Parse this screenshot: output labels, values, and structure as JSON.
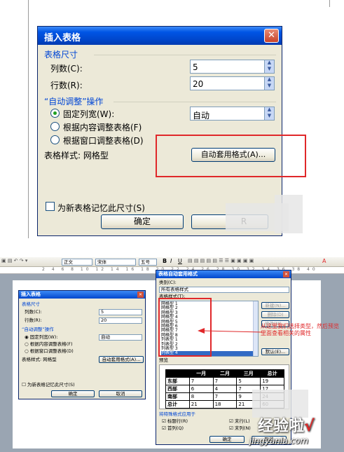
{
  "top_dialog": {
    "title": "插入表格",
    "close_glyph": "✕",
    "size_group": "表格尺寸",
    "columns_label": "列数(C):",
    "columns_value": "5",
    "rows_label": "行数(R):",
    "rows_value": "20",
    "autofit_group": "“自动调整”操作",
    "radio_fixed": "固定列宽(W):",
    "fixed_value": "自动",
    "radio_content": "根据内容调整表格(F)",
    "radio_window": "根据窗口调整表格(D)",
    "style_label": "表格样式: 网格型",
    "autoformat_button": "自动套用格式(A)...",
    "remember_label": "为新表格记忆此尺寸(S)",
    "ok_button": "确定",
    "cancel_partial": "R"
  },
  "toolbar": {
    "style_box": "正文",
    "font_box": "宋体",
    "size_box": "五号",
    "bold": "B",
    "italic": "I",
    "underline": "U",
    "font_color": "A"
  },
  "mini_dialog": {
    "title": "插入表格",
    "size_group": "表格尺寸",
    "columns_label": "列数(C):",
    "columns_value": "5",
    "rows_label": "行数(R):",
    "rows_value": "20",
    "autofit_group": "“自动调整”操作",
    "radio_fixed": "固定列宽(W):",
    "fixed_value": "自动",
    "radio_content": "根据内容调整表格(F)",
    "radio_window": "根据窗口调整表格(D)",
    "style_label": "表格样式: 网格型",
    "autoformat_button": "自动套用格式(A)...",
    "remember_label": "为新表格记忆此尺寸(S)",
    "ok_button": "确定",
    "cancel_button": "取消"
  },
  "autoformat_dialog": {
    "title": "表格自动套用格式",
    "category_label": "类别(C):",
    "category_value": "所有表格样式",
    "styles_label": "表格样式(T):",
    "styles": [
      "网格型 1",
      "网格型 2",
      "网格型 3",
      "网格型 4",
      "网格型 5",
      "网格型 6",
      "网格型 7",
      "网格型 8",
      "列表型 1",
      "列表型 2",
      "列表型 3",
      "列表型 4"
    ],
    "new_button": "新建(N)...",
    "delete_button": "删除(D)",
    "modify_button": "修改(M)...",
    "default_button": "默认(E)...",
    "preview_label": "预览",
    "apply_label": "将特殊格式应用于",
    "check_header": "标题行(R)",
    "check_first_col": "首列(Q)",
    "check_last_row": "末行(L)",
    "check_last_col": "末列(N)",
    "ok_button": "确定",
    "cancel_button": "取消"
  },
  "preview_table": {
    "headers": [
      "",
      "一月",
      "二月",
      "三月",
      "总计"
    ],
    "rows": [
      [
        "东部",
        "7",
        "7",
        "5",
        "19"
      ],
      [
        "西部",
        "6",
        "4",
        "7",
        "17"
      ],
      [
        "南部",
        "8",
        "7",
        "9",
        "24"
      ],
      [
        "总计",
        "21",
        "18",
        "21",
        "60"
      ]
    ]
  },
  "annotation": {
    "line1": "从这里我们选择类型，然后预览",
    "line2": "里面查看相关的属性"
  },
  "watermark": {
    "brand": "经验啦",
    "check": "√",
    "url": "jingyanla.com"
  },
  "colors": {
    "title_blue": "#0047cc",
    "highlight_red": "#e0282a",
    "dialog_bg": "#ece9d8"
  }
}
